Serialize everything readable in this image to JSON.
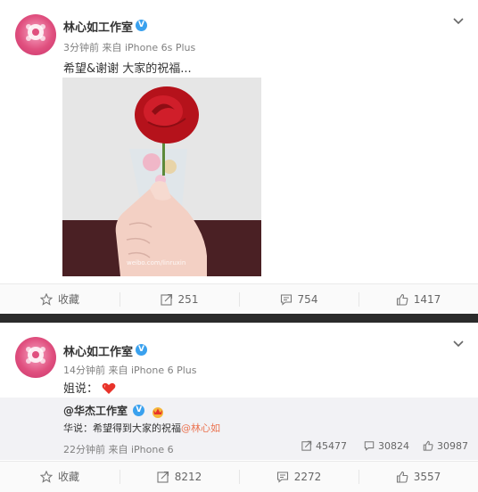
{
  "post1": {
    "author": "林心如工作室",
    "meta": "3分钟前 来自 iPhone 6s Plus",
    "text": "希望&谢谢 大家的祝福...",
    "watermark": "weibo.com/linruxin",
    "actions": {
      "favorite": "收藏",
      "repost": "251",
      "comment": "754",
      "like": "1417"
    }
  },
  "post2": {
    "author": "林心如工作室",
    "meta": "14分钟前 来自 iPhone 6 Plus",
    "text": "姐说：",
    "repost": {
      "author": "@华杰工作室",
      "text_prefix": "华说：希望得到大家的祝福",
      "mention": "@林心如",
      "meta": "22分钟前 来自 iPhone 6",
      "repost_count": "45477",
      "comment_count": "30824",
      "like_count": "30987"
    },
    "actions": {
      "favorite": "收藏",
      "repost": "8212",
      "comment": "2272",
      "like": "3557"
    }
  },
  "colors": {
    "accent": "#eb7350",
    "verified": "#3aa1ee",
    "divider": "#2b2b2b",
    "repost_bg": "#f2f2f5"
  },
  "icons": [
    "star-icon",
    "repost-icon",
    "comment-icon",
    "like-icon",
    "chevron-down-icon",
    "verified-icon",
    "heart-emoji-icon",
    "crown-badge-icon"
  ]
}
